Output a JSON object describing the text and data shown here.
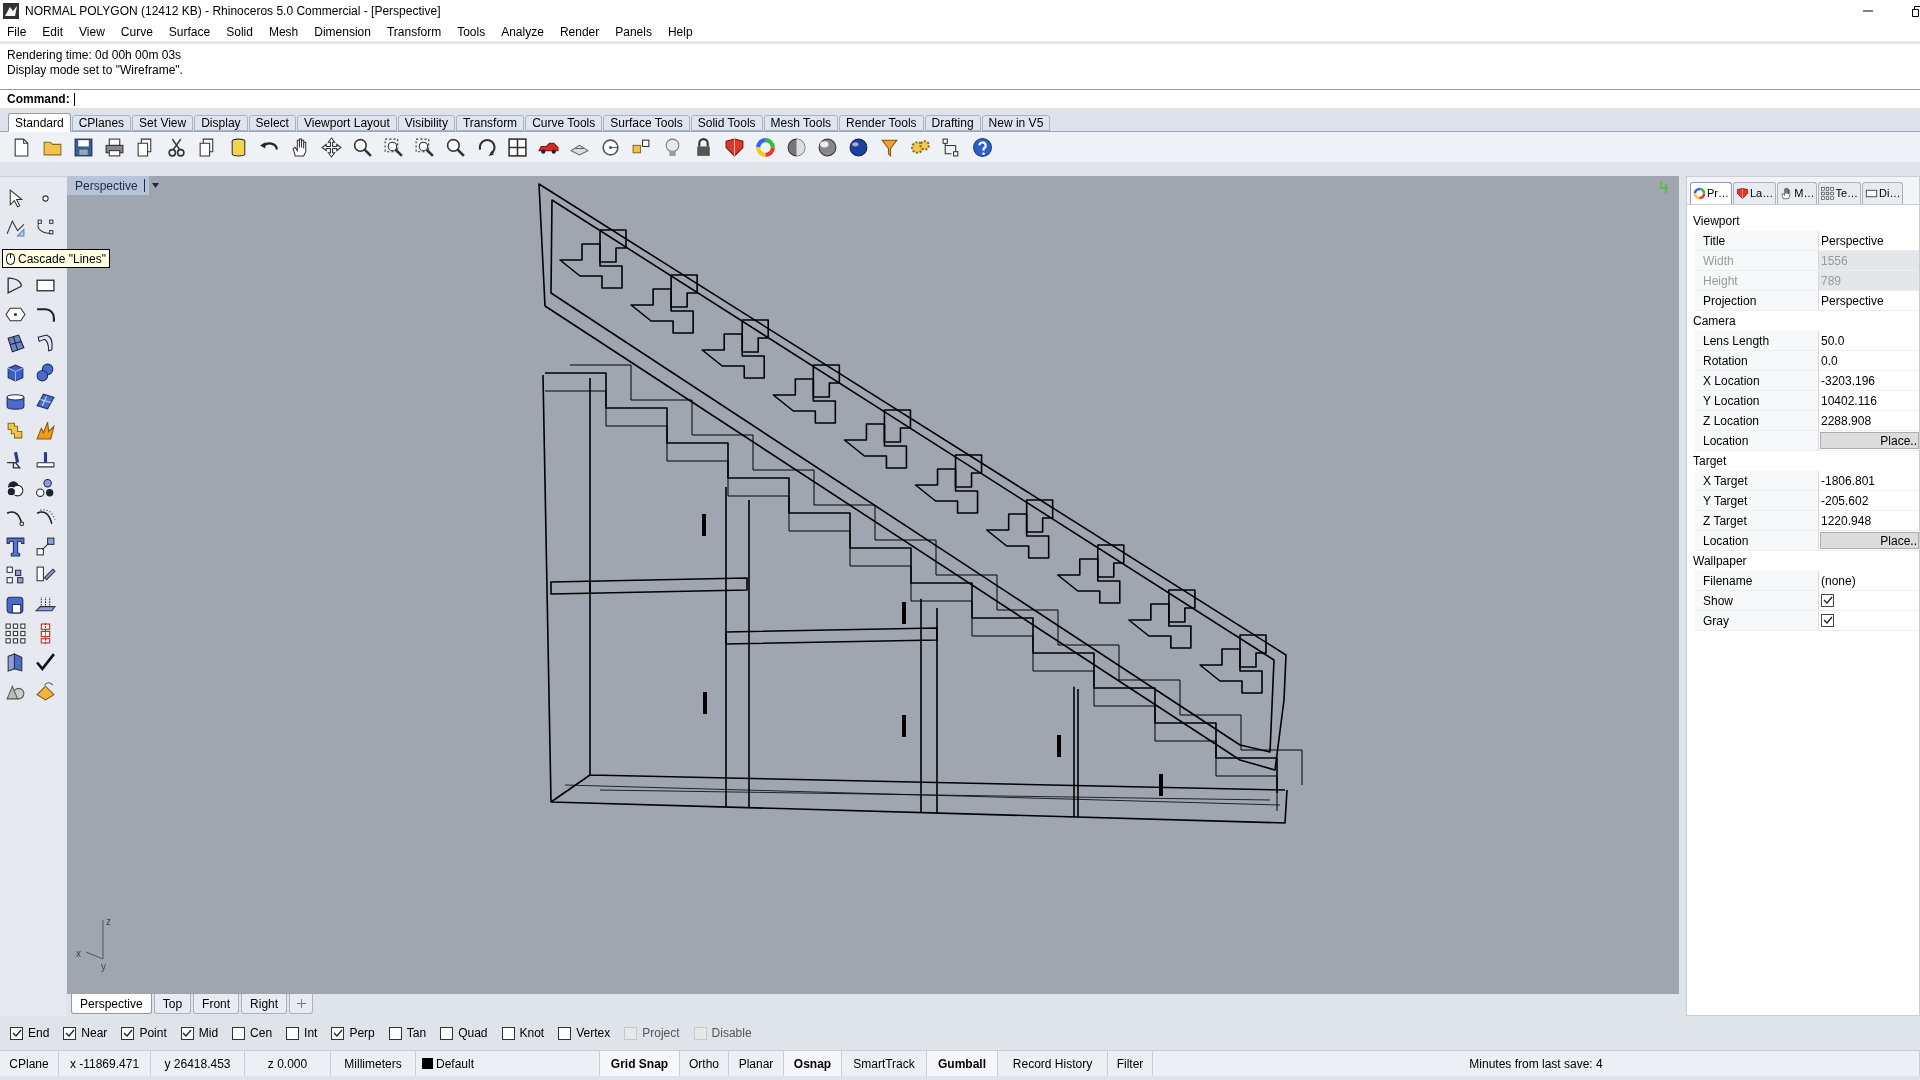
{
  "window": {
    "title": "NORMAL POLYGON (12412 KB) - Rhinoceros 5.0 Commercial - [Perspective]"
  },
  "menu": [
    "File",
    "Edit",
    "View",
    "Curve",
    "Surface",
    "Solid",
    "Mesh",
    "Dimension",
    "Transform",
    "Tools",
    "Analyze",
    "Render",
    "Panels",
    "Help"
  ],
  "command_history": [
    "Rendering time: 0d 00h 00m 03s",
    "Display mode set to \"Wireframe\"."
  ],
  "command": {
    "label": "Command:"
  },
  "toolbar_tabs": [
    {
      "label": "Standard",
      "selected": true
    },
    {
      "label": "CPlanes",
      "selected": false
    },
    {
      "label": "Set View",
      "selected": false
    },
    {
      "label": "Display",
      "selected": false
    },
    {
      "label": "Select",
      "selected": false
    },
    {
      "label": "Viewport Layout",
      "selected": false
    },
    {
      "label": "Visibility",
      "selected": false
    },
    {
      "label": "Transform",
      "selected": false
    },
    {
      "label": "Curve Tools",
      "selected": false
    },
    {
      "label": "Surface Tools",
      "selected": false
    },
    {
      "label": "Solid Tools",
      "selected": false
    },
    {
      "label": "Mesh Tools",
      "selected": false
    },
    {
      "label": "Render Tools",
      "selected": false
    },
    {
      "label": "Drafting",
      "selected": false
    },
    {
      "label": "New in V5",
      "selected": false
    }
  ],
  "tooltip": {
    "text": "Cascade \"Lines\""
  },
  "viewport": {
    "title": "Perspective",
    "axes": [
      "z",
      "x",
      "y"
    ]
  },
  "viewport_tabs": [
    {
      "label": "Perspective",
      "selected": true
    },
    {
      "label": "Top",
      "selected": false
    },
    {
      "label": "Front",
      "selected": false
    },
    {
      "label": "Right",
      "selected": false
    }
  ],
  "osnaps": [
    {
      "label": "End",
      "checked": true,
      "disabled": false
    },
    {
      "label": "Near",
      "checked": true,
      "disabled": false
    },
    {
      "label": "Point",
      "checked": true,
      "disabled": false
    },
    {
      "label": "Mid",
      "checked": true,
      "disabled": false
    },
    {
      "label": "Cen",
      "checked": false,
      "disabled": false
    },
    {
      "label": "Int",
      "checked": false,
      "disabled": false
    },
    {
      "label": "Perp",
      "checked": true,
      "disabled": false
    },
    {
      "label": "Tan",
      "checked": false,
      "disabled": false
    },
    {
      "label": "Quad",
      "checked": false,
      "disabled": false
    },
    {
      "label": "Knot",
      "checked": false,
      "disabled": false
    },
    {
      "label": "Vertex",
      "checked": false,
      "disabled": false
    },
    {
      "label": "Project",
      "checked": false,
      "disabled": true
    },
    {
      "label": "Disable",
      "checked": false,
      "disabled": true
    }
  ],
  "panel": {
    "tabs": [
      {
        "label": "Pr…",
        "selected": true
      },
      {
        "label": "La…",
        "selected": false
      },
      {
        "label": "M…",
        "selected": false
      },
      {
        "label": "Te…",
        "selected": false
      },
      {
        "label": "Di…",
        "selected": false
      }
    ],
    "sections": [
      {
        "title": "Viewport",
        "rows": [
          {
            "label": "Title",
            "value": "Perspective",
            "kind": "text"
          },
          {
            "label": "Width",
            "value": "1556",
            "kind": "readonly"
          },
          {
            "label": "Height",
            "value": "789",
            "kind": "readonly"
          },
          {
            "label": "Projection",
            "value": "Perspective",
            "kind": "text"
          }
        ]
      },
      {
        "title": "Camera",
        "rows": [
          {
            "label": "Lens Length",
            "value": "50.0",
            "kind": "text"
          },
          {
            "label": "Rotation",
            "value": "0.0",
            "kind": "text"
          },
          {
            "label": "X Location",
            "value": "-3203.196",
            "kind": "text"
          },
          {
            "label": "Y Location",
            "value": "10402.116",
            "kind": "text"
          },
          {
            "label": "Z Location",
            "value": "2288.908",
            "kind": "text"
          },
          {
            "label": "Location",
            "value": "Place..",
            "kind": "button"
          }
        ]
      },
      {
        "title": "Target",
        "rows": [
          {
            "label": "X Target",
            "value": "-1806.801",
            "kind": "text"
          },
          {
            "label": "Y Target",
            "value": "-205.602",
            "kind": "text"
          },
          {
            "label": "Z Target",
            "value": "1220.948",
            "kind": "text"
          },
          {
            "label": "Location",
            "value": "Place..",
            "kind": "button"
          }
        ]
      },
      {
        "title": "Wallpaper",
        "rows": [
          {
            "label": "Filename",
            "value": "(none)",
            "kind": "text"
          },
          {
            "label": "Show",
            "kind": "checkbox",
            "checked": true
          },
          {
            "label": "Gray",
            "kind": "checkbox",
            "checked": true
          }
        ]
      }
    ]
  },
  "status_bar": [
    {
      "label": "CPlane",
      "kind": "field"
    },
    {
      "label": "x -11869.471",
      "kind": "field"
    },
    {
      "label": "y 26418.453",
      "kind": "field"
    },
    {
      "label": "z 0.000",
      "kind": "field"
    },
    {
      "label": "Millimeters",
      "kind": "field"
    },
    {
      "label": "Default",
      "kind": "layer"
    },
    {
      "label": "Grid Snap",
      "kind": "toggle",
      "on": true
    },
    {
      "label": "Ortho",
      "kind": "toggle",
      "on": false
    },
    {
      "label": "Planar",
      "kind": "toggle",
      "on": false
    },
    {
      "label": "Osnap",
      "kind": "toggle",
      "on": true
    },
    {
      "label": "SmartTrack",
      "kind": "toggle",
      "on": false
    },
    {
      "label": "Gumball",
      "kind": "toggle",
      "on": true
    },
    {
      "label": "Record History",
      "kind": "toggle",
      "on": false
    },
    {
      "label": "Filter",
      "kind": "toggle",
      "on": false
    },
    {
      "label": "Minutes from last save: 4",
      "kind": "field"
    }
  ]
}
